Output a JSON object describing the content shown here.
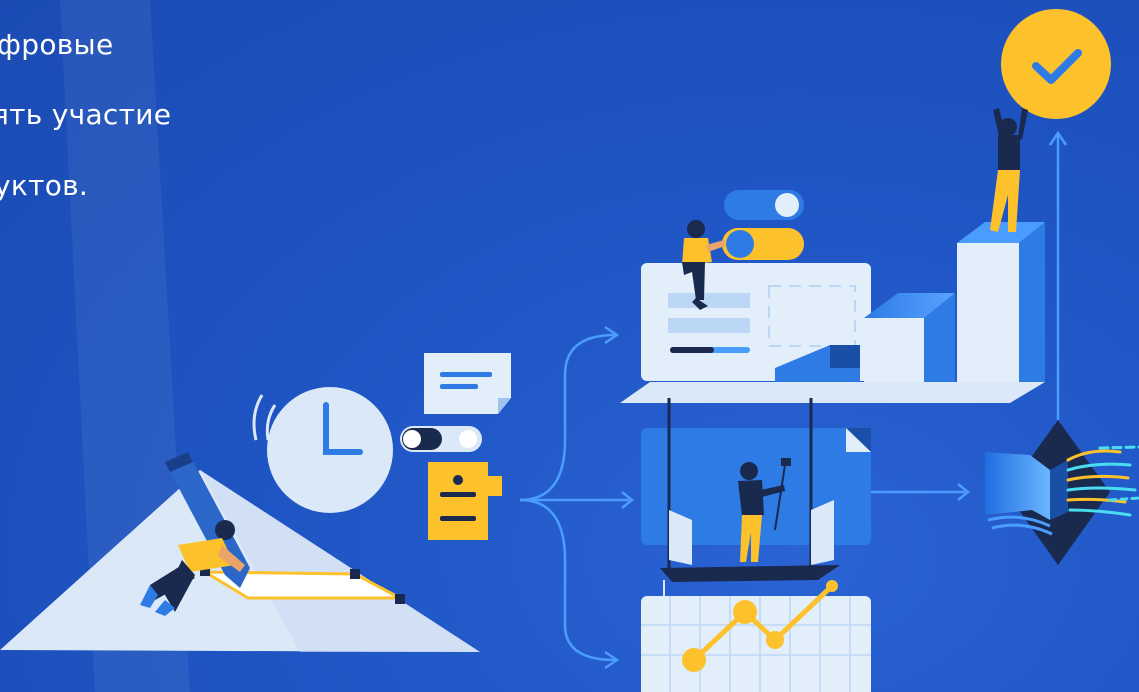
{
  "hero": {
    "lines": [
      "фровые",
      "ять участие",
      "уктов."
    ]
  },
  "colors": {
    "background": "#1f55c4",
    "accent_yellow": "#fcc12b",
    "panel_light": "#e3eefb",
    "panel_blue": "#2e7be6",
    "dark_navy": "#1a2a4f",
    "arrow_blue": "#4a9cff"
  },
  "illustration": {
    "check_badge": "check-icon",
    "clock": "clock-icon",
    "book": "book-icon"
  }
}
